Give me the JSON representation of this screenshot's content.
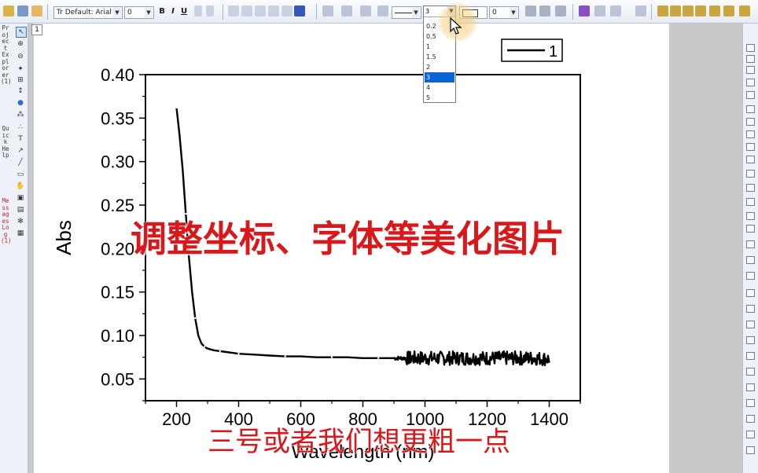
{
  "toolbar": {
    "font_name": "Tr Default: Arial",
    "font_size": "0",
    "bold_label": "B",
    "italic_label": "I",
    "underline_label": "U",
    "line_width_value": "3",
    "pattern_value": "0"
  },
  "left_panel": {
    "project_explorer": "Project Explorer (1)",
    "quick_help": "Quick Help",
    "messages_log": "Messages Log (1)"
  },
  "layer_number": "1",
  "line_width_dropdown": {
    "options": [
      "0.2",
      "0.5",
      "1",
      "1.5",
      "2",
      "3",
      "4",
      "5"
    ],
    "selected": "3"
  },
  "overlay": {
    "caption_main": "调整坐标、字体等美化图片",
    "caption_sub": "三号或者我们想更粗一点"
  },
  "chart_data": {
    "type": "line",
    "xlabel": "Wavelength (nm)",
    "ylabel": "Abs",
    "xlim": [
      100,
      1500
    ],
    "ylim": [
      0.025,
      0.4
    ],
    "x_ticks": [
      200,
      400,
      600,
      800,
      1000,
      1200,
      1400
    ],
    "y_ticks": [
      0.05,
      0.1,
      0.15,
      0.2,
      0.25,
      0.3,
      0.35,
      0.4
    ],
    "legend": "top-right",
    "series": [
      {
        "name": "1",
        "color": "#000000",
        "x": [
          200,
          210,
          220,
          230,
          240,
          250,
          260,
          270,
          280,
          290,
          300,
          320,
          340,
          360,
          380,
          400,
          450,
          500,
          550,
          600,
          650,
          700,
          750,
          800,
          850,
          900,
          950,
          1000,
          1050,
          1100,
          1150,
          1200,
          1250,
          1300,
          1350,
          1400
        ],
        "y": [
          0.362,
          0.33,
          0.29,
          0.24,
          0.19,
          0.15,
          0.12,
          0.1,
          0.091,
          0.087,
          0.085,
          0.083,
          0.082,
          0.081,
          0.08,
          0.079,
          0.078,
          0.077,
          0.076,
          0.076,
          0.075,
          0.075,
          0.075,
          0.074,
          0.074,
          0.074,
          0.074,
          0.074,
          0.074,
          0.074,
          0.074,
          0.074,
          0.074,
          0.074,
          0.074,
          0.073
        ],
        "noise_from_x": 900,
        "noise_amplitude": 0.008
      }
    ]
  },
  "colors": {
    "caption": "#d8181b",
    "selection": "#0a64d6",
    "workspace": "#c9c9c9"
  }
}
